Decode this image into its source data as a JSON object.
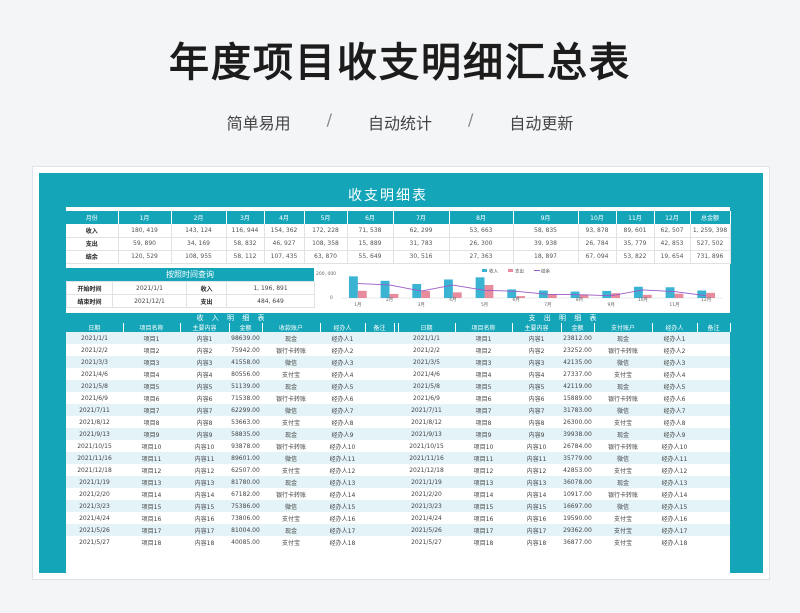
{
  "header": {
    "title": "年度项目收支明细汇总表",
    "tags": [
      "简单易用",
      "自动统计",
      "自动更新"
    ],
    "separator": "/"
  },
  "sheet": {
    "title": "收支明细表",
    "colors": {
      "accent": "#14a5b8",
      "income_bar": "#3bb4d4",
      "expense_bar": "#e88b9c",
      "balance_line": "#9b59c6",
      "row_alt": "#e3f3f8"
    }
  },
  "summary": {
    "corner": "月份",
    "months": [
      "1月",
      "2月",
      "3月",
      "4月",
      "5月",
      "6月",
      "7月",
      "8月",
      "9月",
      "10月",
      "11月",
      "12月"
    ],
    "total_label": "总金额",
    "rows": [
      {
        "label": "收入",
        "values": [
          "180, 419",
          "143, 124",
          "116, 944",
          "154, 362",
          "172, 228",
          "71, 538",
          "62, 299",
          "53, 663",
          "58, 835",
          "93, 878",
          "89, 601",
          "62, 507"
        ],
        "total": "1, 259, 398"
      },
      {
        "label": "支出",
        "values": [
          "59, 890",
          "34, 169",
          "58, 832",
          "46, 927",
          "108, 358",
          "15, 889",
          "31, 783",
          "26, 300",
          "39, 938",
          "26, 784",
          "35, 779",
          "42, 853"
        ],
        "total": "527, 502"
      },
      {
        "label": "结余",
        "values": [
          "120, 529",
          "108, 955",
          "58, 112",
          "107, 435",
          "63, 870",
          "55, 649",
          "30, 516",
          "27, 363",
          "18, 897",
          "67, 094",
          "53, 822",
          "19, 654"
        ],
        "total": "731, 896"
      }
    ]
  },
  "query": {
    "title": "按照时间查询",
    "start_label": "开始时间",
    "start_value": "2021/1/1",
    "end_label": "结束时间",
    "end_value": "2021/12/1",
    "income_label": "收入",
    "income_value": "1, 196, 891",
    "expense_label": "支出",
    "expense_value": "484, 649"
  },
  "chart_data": {
    "type": "bar",
    "categories": [
      "1月",
      "2月",
      "3月",
      "4月",
      "5月",
      "6月",
      "7月",
      "8月",
      "9月",
      "10月",
      "11月",
      "12月"
    ],
    "series": [
      {
        "name": "收入",
        "type": "bar",
        "values": [
          180419,
          143124,
          116944,
          154362,
          172228,
          71538,
          62299,
          53663,
          58835,
          93878,
          89601,
          62507
        ]
      },
      {
        "name": "支出",
        "type": "bar",
        "values": [
          59890,
          34169,
          58832,
          46927,
          108358,
          15889,
          31783,
          26300,
          39938,
          26784,
          35779,
          42853
        ]
      },
      {
        "name": "结余",
        "type": "line",
        "values": [
          120529,
          108955,
          58112,
          107435,
          63870,
          55649,
          30516,
          27363,
          18897,
          67094,
          53822,
          19654
        ]
      }
    ],
    "y_tick_labels": [
      "200, 000",
      "0"
    ],
    "ylim": [
      0,
      200000
    ],
    "x_tick_labels": [
      "1月",
      "3月",
      "5月",
      "7月",
      "9月",
      "11月"
    ],
    "x_tick_labels_top": [
      "2月",
      "4月",
      "6月",
      "8月",
      "10月",
      "12月"
    ],
    "legend_position": "top"
  },
  "income_detail": {
    "title": "收 入 明 细 表",
    "columns": [
      "日期",
      "项目名称",
      "主要内容",
      "金额",
      "收款账户",
      "经办人",
      "备注"
    ],
    "rows": [
      [
        "2021/1/1",
        "项目1",
        "内容1",
        "98639.00",
        "现金",
        "经办人1",
        ""
      ],
      [
        "2021/2/2",
        "项目2",
        "内容2",
        "75942.00",
        "银行卡转账",
        "经办人2",
        ""
      ],
      [
        "2021/3/3",
        "项目3",
        "内容3",
        "41558.00",
        "微信",
        "经办人3",
        ""
      ],
      [
        "2021/4/6",
        "项目4",
        "内容4",
        "80556.00",
        "支付宝",
        "经办人4",
        ""
      ],
      [
        "2021/5/8",
        "项目5",
        "内容5",
        "51139.00",
        "现金",
        "经办人5",
        ""
      ],
      [
        "2021/6/9",
        "项目6",
        "内容6",
        "71538.00",
        "银行卡转账",
        "经办人6",
        ""
      ],
      [
        "2021/7/11",
        "项目7",
        "内容7",
        "62299.00",
        "微信",
        "经办人7",
        ""
      ],
      [
        "2021/8/12",
        "项目8",
        "内容8",
        "53663.00",
        "支付宝",
        "经办人8",
        ""
      ],
      [
        "2021/9/13",
        "项目9",
        "内容9",
        "58835.00",
        "现金",
        "经办人9",
        ""
      ],
      [
        "2021/10/15",
        "项目10",
        "内容10",
        "93878.00",
        "银行卡转账",
        "经办人10",
        ""
      ],
      [
        "2021/11/16",
        "项目11",
        "内容11",
        "89601.00",
        "微信",
        "经办人11",
        ""
      ],
      [
        "2021/12/18",
        "项目12",
        "内容12",
        "62507.00",
        "支付宝",
        "经办人12",
        ""
      ],
      [
        "2021/1/19",
        "项目13",
        "内容13",
        "81780.00",
        "现金",
        "经办人13",
        ""
      ],
      [
        "2021/2/20",
        "项目14",
        "内容14",
        "67182.00",
        "银行卡转账",
        "经办人14",
        ""
      ],
      [
        "2021/3/23",
        "项目15",
        "内容15",
        "75386.00",
        "微信",
        "经办人15",
        ""
      ],
      [
        "2021/4/24",
        "项目16",
        "内容16",
        "73806.00",
        "支付宝",
        "经办人16",
        ""
      ],
      [
        "2021/5/26",
        "项目17",
        "内容17",
        "81004.00",
        "现金",
        "经办人17",
        ""
      ],
      [
        "2021/5/27",
        "项目18",
        "内容18",
        "40085.00",
        "支付宝",
        "经办人18",
        ""
      ]
    ]
  },
  "expense_detail": {
    "title": "支 出 明 细 表",
    "columns": [
      "日期",
      "项目名称",
      "主要内容",
      "金额",
      "支付账户",
      "经办人",
      "备注"
    ],
    "rows": [
      [
        "2021/1/1",
        "项目1",
        "内容1",
        "23812.00",
        "现金",
        "经办人1",
        ""
      ],
      [
        "2021/2/2",
        "项目2",
        "内容2",
        "23252.00",
        "银行卡转账",
        "经办人2",
        ""
      ],
      [
        "2021/3/5",
        "项目3",
        "内容3",
        "42135.00",
        "微信",
        "经办人3",
        ""
      ],
      [
        "2021/4/6",
        "项目4",
        "内容4",
        "27337.00",
        "支付宝",
        "经办人4",
        ""
      ],
      [
        "2021/5/8",
        "项目5",
        "内容5",
        "42119.00",
        "现金",
        "经办人5",
        ""
      ],
      [
        "2021/6/9",
        "项目6",
        "内容6",
        "15889.00",
        "银行卡转账",
        "经办人6",
        ""
      ],
      [
        "2021/7/11",
        "项目7",
        "内容7",
        "31783.00",
        "微信",
        "经办人7",
        ""
      ],
      [
        "2021/8/12",
        "项目8",
        "内容8",
        "26300.00",
        "支付宝",
        "经办人8",
        ""
      ],
      [
        "2021/9/13",
        "项目9",
        "内容9",
        "39938.00",
        "现金",
        "经办人9",
        ""
      ],
      [
        "2021/10/15",
        "项目10",
        "内容10",
        "26784.00",
        "银行卡转账",
        "经办人10",
        ""
      ],
      [
        "2021/11/16",
        "项目11",
        "内容11",
        "35779.00",
        "微信",
        "经办人11",
        ""
      ],
      [
        "2021/12/18",
        "项目12",
        "内容12",
        "42853.00",
        "支付宝",
        "经办人12",
        ""
      ],
      [
        "2021/1/19",
        "项目13",
        "内容13",
        "36078.00",
        "现金",
        "经办人13",
        ""
      ],
      [
        "2021/2/20",
        "项目14",
        "内容14",
        "10917.00",
        "银行卡转账",
        "经办人14",
        ""
      ],
      [
        "2021/3/23",
        "项目15",
        "内容15",
        "16697.00",
        "微信",
        "经办人15",
        ""
      ],
      [
        "2021/4/24",
        "项目16",
        "内容16",
        "19590.00",
        "支付宝",
        "经办人16",
        ""
      ],
      [
        "2021/5/26",
        "项目17",
        "内容17",
        "29362.00",
        "支付宝",
        "经办人17",
        ""
      ],
      [
        "2021/5/27",
        "项目18",
        "内容18",
        "36877.00",
        "支付宝",
        "经办人18",
        ""
      ]
    ]
  }
}
